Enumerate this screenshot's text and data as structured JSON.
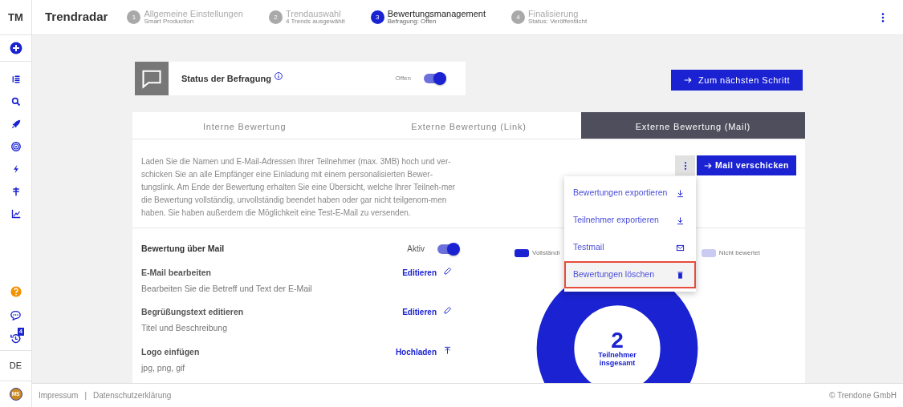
{
  "sidebar": {
    "logo": "TM",
    "badge": "4",
    "language": "DE",
    "avatar": "MS"
  },
  "header": {
    "title": "Trendradar",
    "steps": [
      {
        "number": "1",
        "title": "Allgemeine Einstellungen",
        "subtitle": "Smart Production",
        "selected": false
      },
      {
        "number": "2",
        "title": "Trendauswahl",
        "subtitle": "4 Trends ausgewählt",
        "selected": false
      },
      {
        "number": "3",
        "title": "Bewertungsmanagement",
        "subtitle": "Befragung: Offen",
        "selected": true
      },
      {
        "number": "4",
        "title": "Finalisierung",
        "subtitle": "Status: Veröffentlicht",
        "selected": false
      }
    ]
  },
  "status_card": {
    "label": "Status der Befragung",
    "toggle_label": "Offen",
    "on": true
  },
  "next_button": "Zum nächsten Schritt",
  "tabs": [
    {
      "label": "Interne Bewertung",
      "selected": false
    },
    {
      "label": "Externe Bewertung (Link)",
      "selected": false
    },
    {
      "label": "Externe Bewertung (Mail)",
      "selected": true
    }
  ],
  "description": "Laden Sie die Namen und E-Mail-Adressen Ihrer Teilnehmer (max. 3MB) hoch und ver-schicken Sie an alle Empfänger eine Einladung mit einem personalisierten Bewer-tungslink. Am Ende der Bewertung erhalten Sie eine Übersicht, welche Ihrer Teilneh-mer die Bewertung vollständig, unvollständig beendet haben oder gar nicht teilgenom-men haben. Sie haben außerdem die Möglichkeit eine Test-E-Mail zu versenden.",
  "mail_button": "Mail verschicken",
  "menu": [
    {
      "label": "Bewertungen exportieren",
      "kind": "download",
      "selected": false
    },
    {
      "label": "Teilnehmer exportieren",
      "kind": "download",
      "selected": false
    },
    {
      "label": "Testmail",
      "kind": "mail",
      "selected": false
    },
    {
      "label": "Bewertungen löschen",
      "kind": "trash",
      "selected": true
    }
  ],
  "mail_settings": {
    "title": "Bewertung über Mail",
    "toggle_label": "Aktiv",
    "on": true,
    "items": [
      {
        "title": "E-Mail bearbeiten",
        "subtitle": "Bearbeiten Sie die Betreff und Text der E-Mail",
        "action": "Editieren",
        "kind": "edit"
      },
      {
        "title": "Begrüßungstext editieren",
        "subtitle": "Titel und Beschreibung",
        "action": "Editieren",
        "kind": "edit"
      },
      {
        "title": "Logo einfügen",
        "subtitle": "jpg, png, gif",
        "action": "Hochladen",
        "kind": "upload"
      }
    ]
  },
  "chart": {
    "legend": [
      {
        "label": "Vollständi",
        "color": "#1a22d1"
      },
      {
        "label": "Nicht bewertet",
        "color": "#c9cbf2"
      }
    ],
    "total": "2",
    "total_label": "Teilnehmer insgesamt"
  },
  "footer": {
    "links": [
      "Impressum",
      "Datenschutzerklärung"
    ],
    "separator": "|",
    "copyright": "© Trendone GmbH"
  }
}
